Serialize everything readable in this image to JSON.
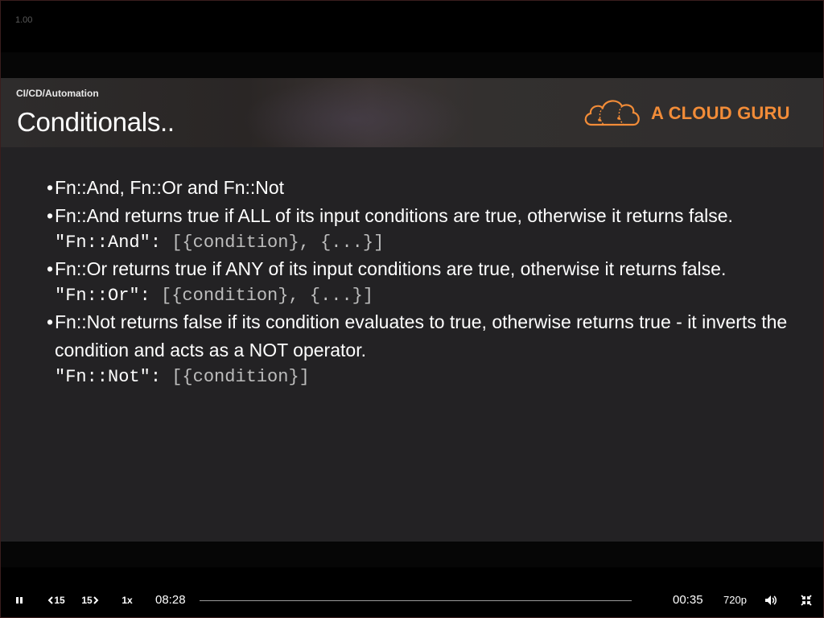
{
  "player": {
    "version_label": "1.00",
    "elapsed_time": "08:28",
    "remaining_time": "00:35",
    "speed_label": "1x",
    "rewind_label": "15",
    "forward_label": "15",
    "quality_label": "720p",
    "progress_fraction": 0.0
  },
  "slide": {
    "breadcrumb": "CI/CD/Automation",
    "title": "Conditionals..",
    "logo_text": "A CLOUD GURU",
    "items": [
      {
        "type": "bullet",
        "text": "Fn::And, Fn::Or and Fn::Not"
      },
      {
        "type": "bullet",
        "text": "Fn::And returns true if ALL of its input conditions are true, otherwise it returns false."
      },
      {
        "type": "code",
        "key": "\"Fn::And\":",
        "value": " [{condition}, {...}]"
      },
      {
        "type": "bullet",
        "text": "Fn::Or returns true if ANY of its input conditions are true, otherwise it returns false."
      },
      {
        "type": "code",
        "key": "\"Fn::Or\":",
        "value": " [{condition}, {...}]"
      },
      {
        "type": "bullet",
        "text": "Fn::Not returns false if its condition evaluates to true, otherwise returns true - it inverts the condition and acts as a NOT operator."
      },
      {
        "type": "code",
        "key": "\"Fn::Not\":",
        "value": " [{condition}]"
      }
    ]
  },
  "colors": {
    "brand": "#f28c38",
    "slide_bg": "#232224",
    "player_bg": "#000000"
  },
  "icons": {
    "play_pause": "pause-icon",
    "rewind": "rewind-15-icon",
    "forward": "forward-15-icon",
    "volume": "volume-icon",
    "exit_fullscreen": "exit-fullscreen-icon",
    "logo": "cloud-logo-icon"
  }
}
